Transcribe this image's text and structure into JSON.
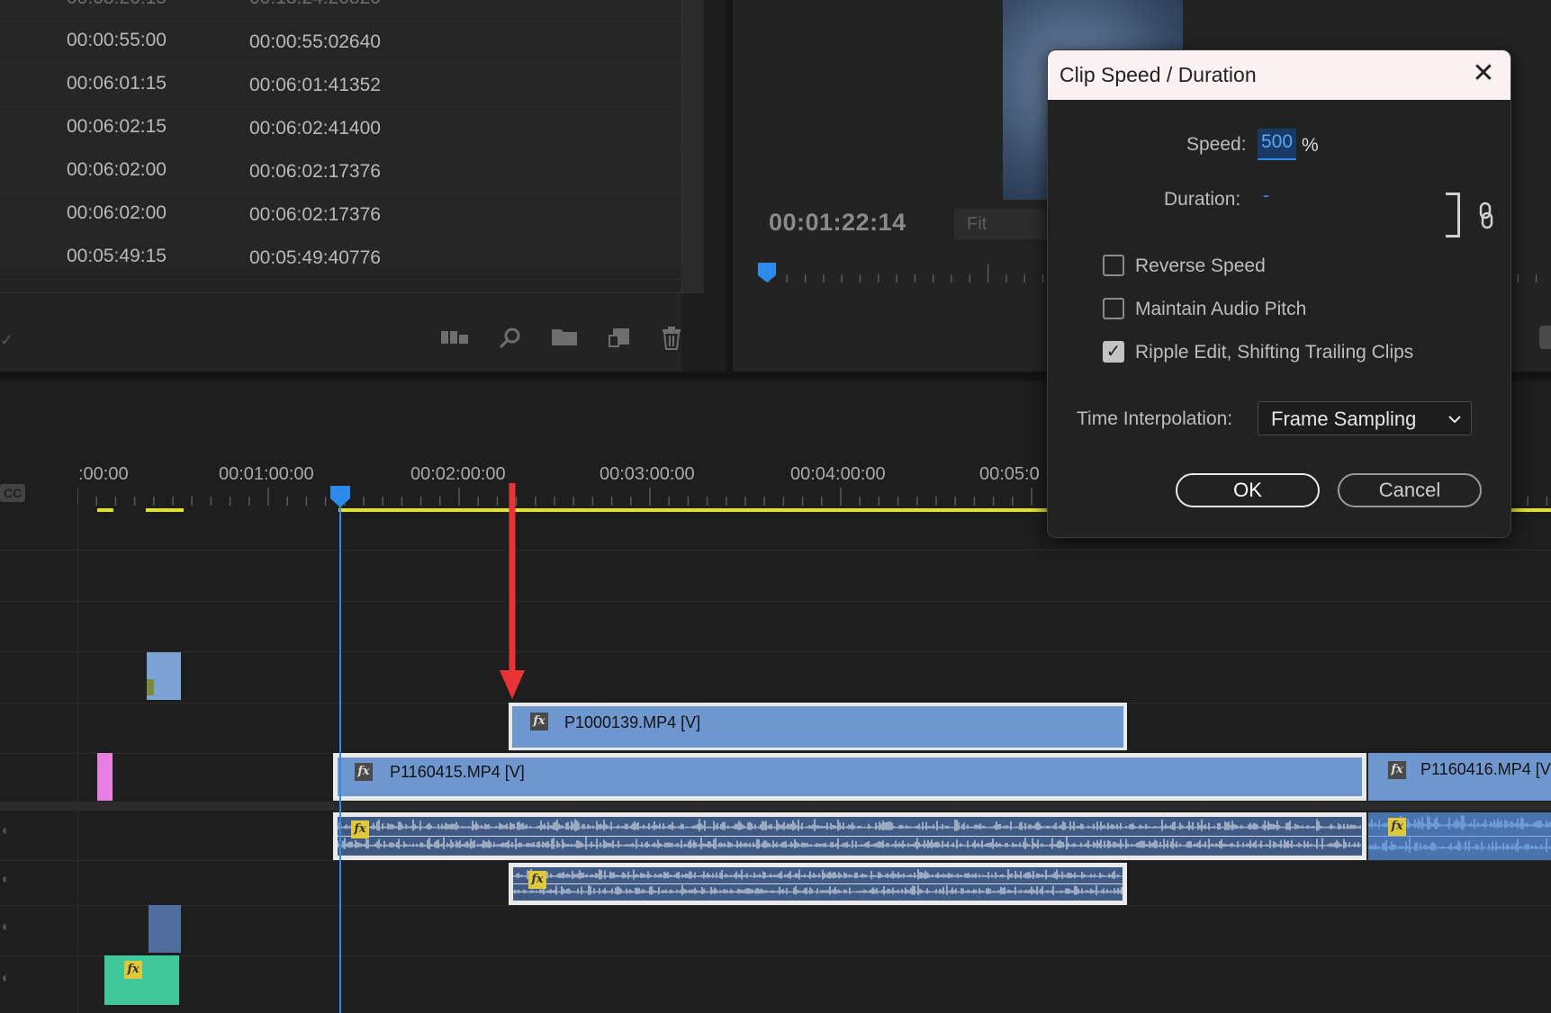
{
  "project_panel": {
    "rows": [
      {
        "a": "00:00:55:00",
        "b": "00:00:55:02640"
      },
      {
        "a": "00:06:01:15",
        "b": "00:06:01:41352"
      },
      {
        "a": "00:06:02:15",
        "b": "00:06:02:41400"
      },
      {
        "a": "00:06:02:00",
        "b": "00:06:02:17376"
      },
      {
        "a": "00:06:02:00",
        "b": "00:06:02:17376"
      },
      {
        "a": "00:05:49:15",
        "b": "00:05:49:40776"
      }
    ],
    "toolbar_icons": [
      "bin-view-icon",
      "search-icon",
      "folder-icon",
      "new-item-icon",
      "trash-icon"
    ]
  },
  "program_monitor": {
    "timecode": "00:01:22:14",
    "fit_label": "Fit"
  },
  "timeline": {
    "ruler_labels": [
      ":00:00",
      "00:01:00:00",
      "00:02:00:00",
      "00:03:00:00",
      "00:04:00:00",
      "00:05:0"
    ],
    "cc_label": "CC",
    "clips": {
      "v2_clip": "P1000139.MP4 [V]",
      "v1_clip_a": "P1160415.MP4 [V]",
      "v1_clip_b": "P1160416.MP4 [V"
    },
    "fx_label": "fx"
  },
  "dialog": {
    "title": "Clip Speed / Duration",
    "close_glyph": "✕",
    "speed_label": "Speed:",
    "speed_value": "500",
    "speed_unit": "%",
    "duration_label": "Duration:",
    "duration_value": "-",
    "reverse_speed": {
      "label": "Reverse Speed",
      "checked": false
    },
    "maintain_pitch": {
      "label": "Maintain Audio Pitch",
      "checked": false
    },
    "ripple_edit": {
      "label": "Ripple Edit, Shifting Trailing Clips",
      "checked": true
    },
    "interp_label": "Time Interpolation:",
    "interp_value": "Frame Sampling",
    "ok_label": "OK",
    "cancel_label": "Cancel"
  },
  "colors": {
    "accent_blue": "#2d8ceb",
    "clip_blue": "#6f97cf",
    "work_area_yellow": "#e5e21f",
    "annotation_red": "#e83434"
  }
}
